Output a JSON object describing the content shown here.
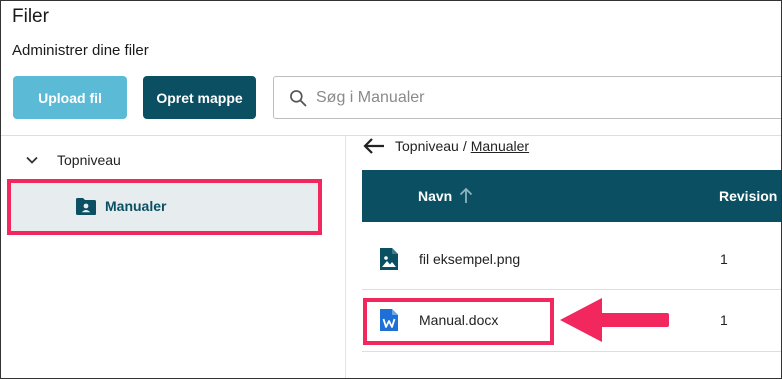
{
  "header": {
    "title": "Filer",
    "subtitle": "Administrer dine filer"
  },
  "toolbar": {
    "upload_label": "Upload fil",
    "new_folder_label": "Opret mappe",
    "search_placeholder": "Søg i Manualer"
  },
  "tree": {
    "root_label": "Topniveau",
    "items": [
      {
        "label": "Manualer",
        "selected": true
      }
    ]
  },
  "breadcrumb": {
    "root": "Topniveau",
    "separator": "/",
    "current": "Manualer"
  },
  "table": {
    "columns": [
      "Navn",
      "Revision"
    ],
    "sort_icon": "arrow-up-icon",
    "rows": [
      {
        "name": "fil eksempel.png",
        "revision": "1",
        "icon": "image-file-icon"
      },
      {
        "name": "Manual.docx",
        "revision": "1",
        "icon": "word-file-icon"
      }
    ]
  },
  "colors": {
    "primary": "#0b4f63",
    "upload_button": "#5bbad5",
    "highlight": "#f2275d",
    "selected_bg": "#e7ecef",
    "word_blue": "#1e6fd6"
  }
}
